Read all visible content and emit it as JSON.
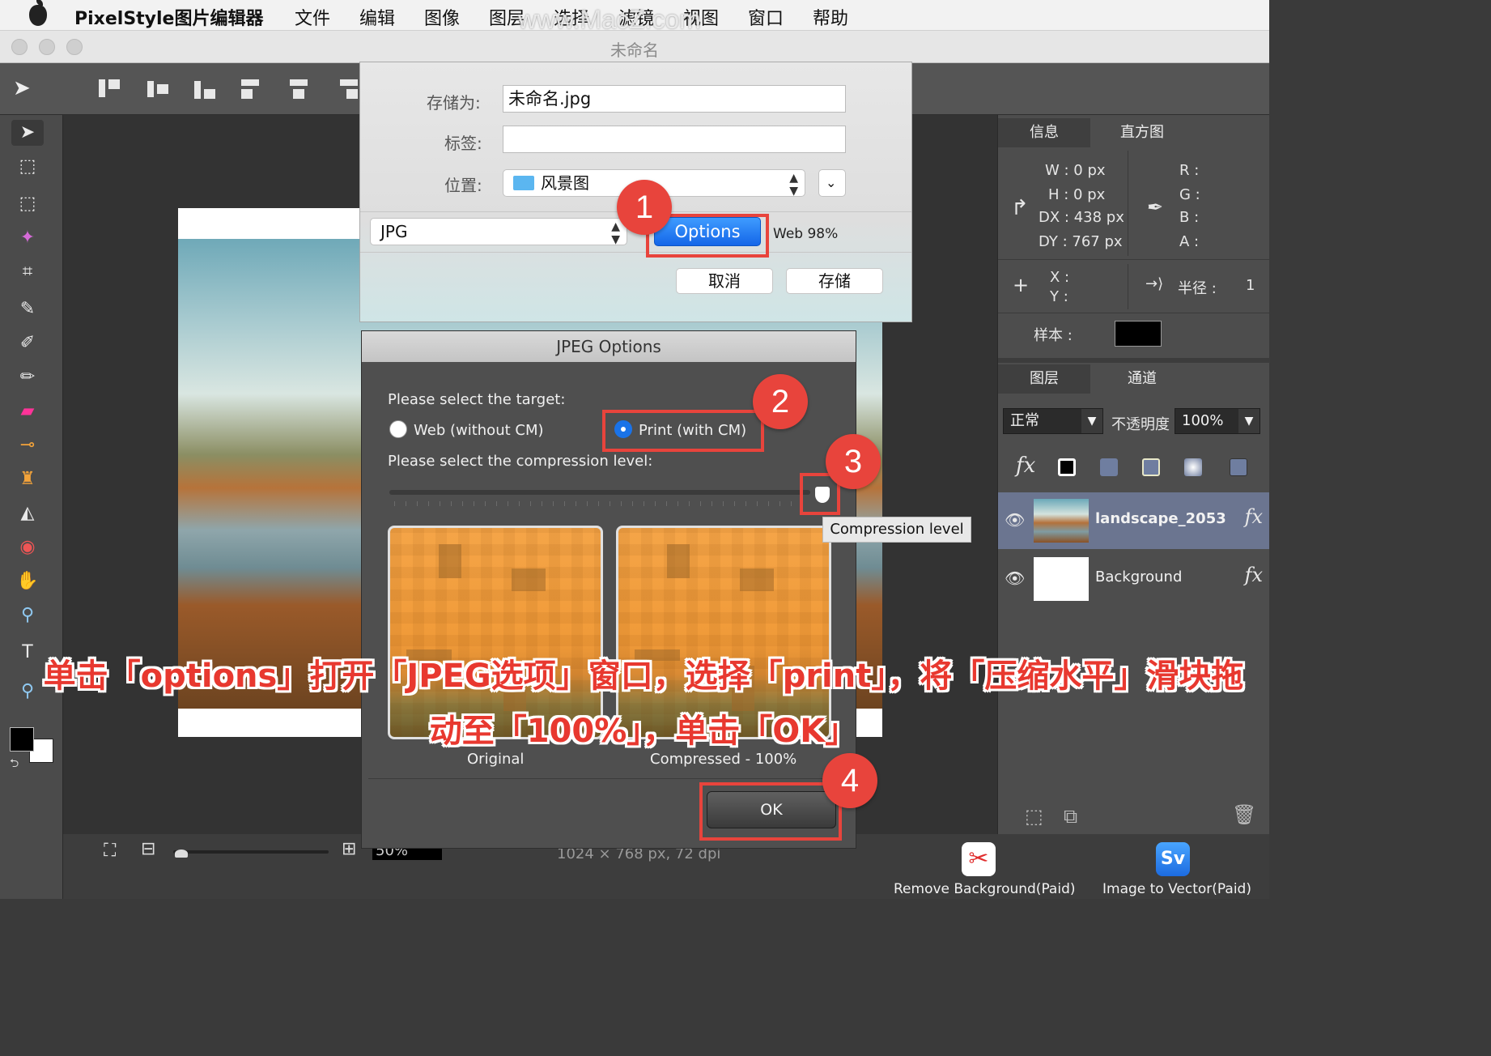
{
  "menubar": {
    "app_name": "PixelStyle图片编辑器",
    "items": [
      "文件",
      "编辑",
      "图像",
      "图层",
      "选择",
      "滤镜",
      "视图",
      "窗口",
      "帮助"
    ],
    "watermark": "www.MacZ.com"
  },
  "window": {
    "title": "未命名"
  },
  "save_dialog": {
    "save_as_label": "存储为:",
    "save_as_value": "未命名.jpg",
    "tags_label": "标签:",
    "tags_value": "",
    "location_label": "位置:",
    "location_value": "风景图",
    "format_value": "JPG",
    "options_button": "Options",
    "quality_text": "Web 98%",
    "cancel_button": "取消",
    "save_button": "存储"
  },
  "jpeg_dialog": {
    "title": "JPEG Options",
    "target_prompt": "Please select the target:",
    "target_web": "Web (without CM)",
    "target_print": "Print (with CM)",
    "selected_target": "print",
    "compression_prompt": "Please select the compression level:",
    "compression_level": 1.0,
    "tooltip": "Compression level",
    "original_label": "Original",
    "compressed_label": "Compressed - 100%",
    "ok_button": "OK"
  },
  "info_panel": {
    "tabs": [
      "信息",
      "直方图"
    ],
    "w": "W :  0 px",
    "h": "H :  0 px",
    "dx": "DX :  438 px",
    "dy": "DY :  767 px",
    "r": "R :",
    "g": "G :",
    "b": "B :",
    "a": "A :",
    "x": "X :",
    "y": "Y :",
    "radius_label": "半径 :",
    "radius_value": "1",
    "sample_label": "样本 :",
    "sample_color": "#000000"
  },
  "layers_panel": {
    "tabs": [
      "图层",
      "通道"
    ],
    "blend_mode": "正常",
    "opacity_label": "不透明度",
    "opacity_value": "100%",
    "fx_label": "fx",
    "layers": [
      {
        "name": "landscape_2053",
        "fx": "fx"
      },
      {
        "name": "Background",
        "fx": "fx"
      }
    ]
  },
  "statusbar": {
    "zoom": "50%",
    "doc_info": "1024 × 768 px, 72 dpi"
  },
  "plugins": {
    "remove_bg": "Remove Background(Paid)",
    "img_to_vector": "Image to Vector(Paid)"
  },
  "annotations": {
    "badges": [
      "1",
      "2",
      "3",
      "4"
    ],
    "caption_line1": "单击「options」打开「JPEG选项」窗口，选择「print」，将「压缩水平」滑块拖",
    "caption_line2": "动至「100%」，单击「OK」"
  },
  "colors": {
    "accent_blue": "#1466e8",
    "callout_red": "#e8443c",
    "panel_bg": "#4d4d4d"
  }
}
